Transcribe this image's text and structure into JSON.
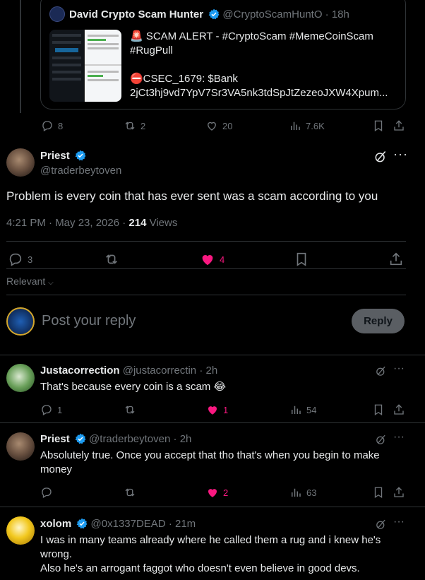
{
  "quoted": {
    "display_name": "David Crypto Scam Hunter",
    "handle": "@CryptoScamHuntO",
    "time": "18h",
    "line1": "🚨 SCAM ALERT - #CryptoScam #MemeCoinScam",
    "line2": "#RugPull",
    "line3": "⛔CSEC_1679: $Bank",
    "line4": "2jCt3hj9vd7YpV7Sr3VA5nk3tdSpJtZezeoJXW4Xpum..."
  },
  "quoted_actions": {
    "replies": "8",
    "reposts": "2",
    "likes": "20",
    "views": "7.6K"
  },
  "main": {
    "display_name": "Priest",
    "handle": "@traderbeytoven",
    "text": "Problem is every coin that has ever sent was a scam according to you",
    "timestamp": "4:21 PM · May 23, 2026 · ",
    "views_count": "214",
    "views_label": " Views"
  },
  "main_actions": {
    "replies": "3",
    "likes": "4"
  },
  "sort": {
    "label": "Relevant"
  },
  "composer": {
    "placeholder": "Post your reply",
    "button": "Reply"
  },
  "replies": [
    {
      "display_name": "Justacorrection",
      "handle": "@justacorrectin",
      "time": "2h",
      "text": "That's because every coin is a scam 😂",
      "replies": "1",
      "reposts": "",
      "likes": "1",
      "views": "54"
    },
    {
      "display_name": "Priest",
      "handle": "@traderbeytoven",
      "time": "2h",
      "text": "Absolutely true.  Once you accept that tho that's when you begin to make money",
      "replies": "",
      "reposts": "",
      "likes": "2",
      "views": "63"
    },
    {
      "display_name": "xolom",
      "handle": "@0x1337DEAD",
      "time": "21m",
      "text1": "I was in many teams already where he called them a rug and i knew he's wrong.",
      "text2": "Also he's an arrogant faggot who doesn't even believe in good devs."
    }
  ],
  "colors": {
    "accent": "#1d9bf0",
    "like": "#f91880",
    "muted": "#71767b",
    "border": "#2f3336"
  }
}
